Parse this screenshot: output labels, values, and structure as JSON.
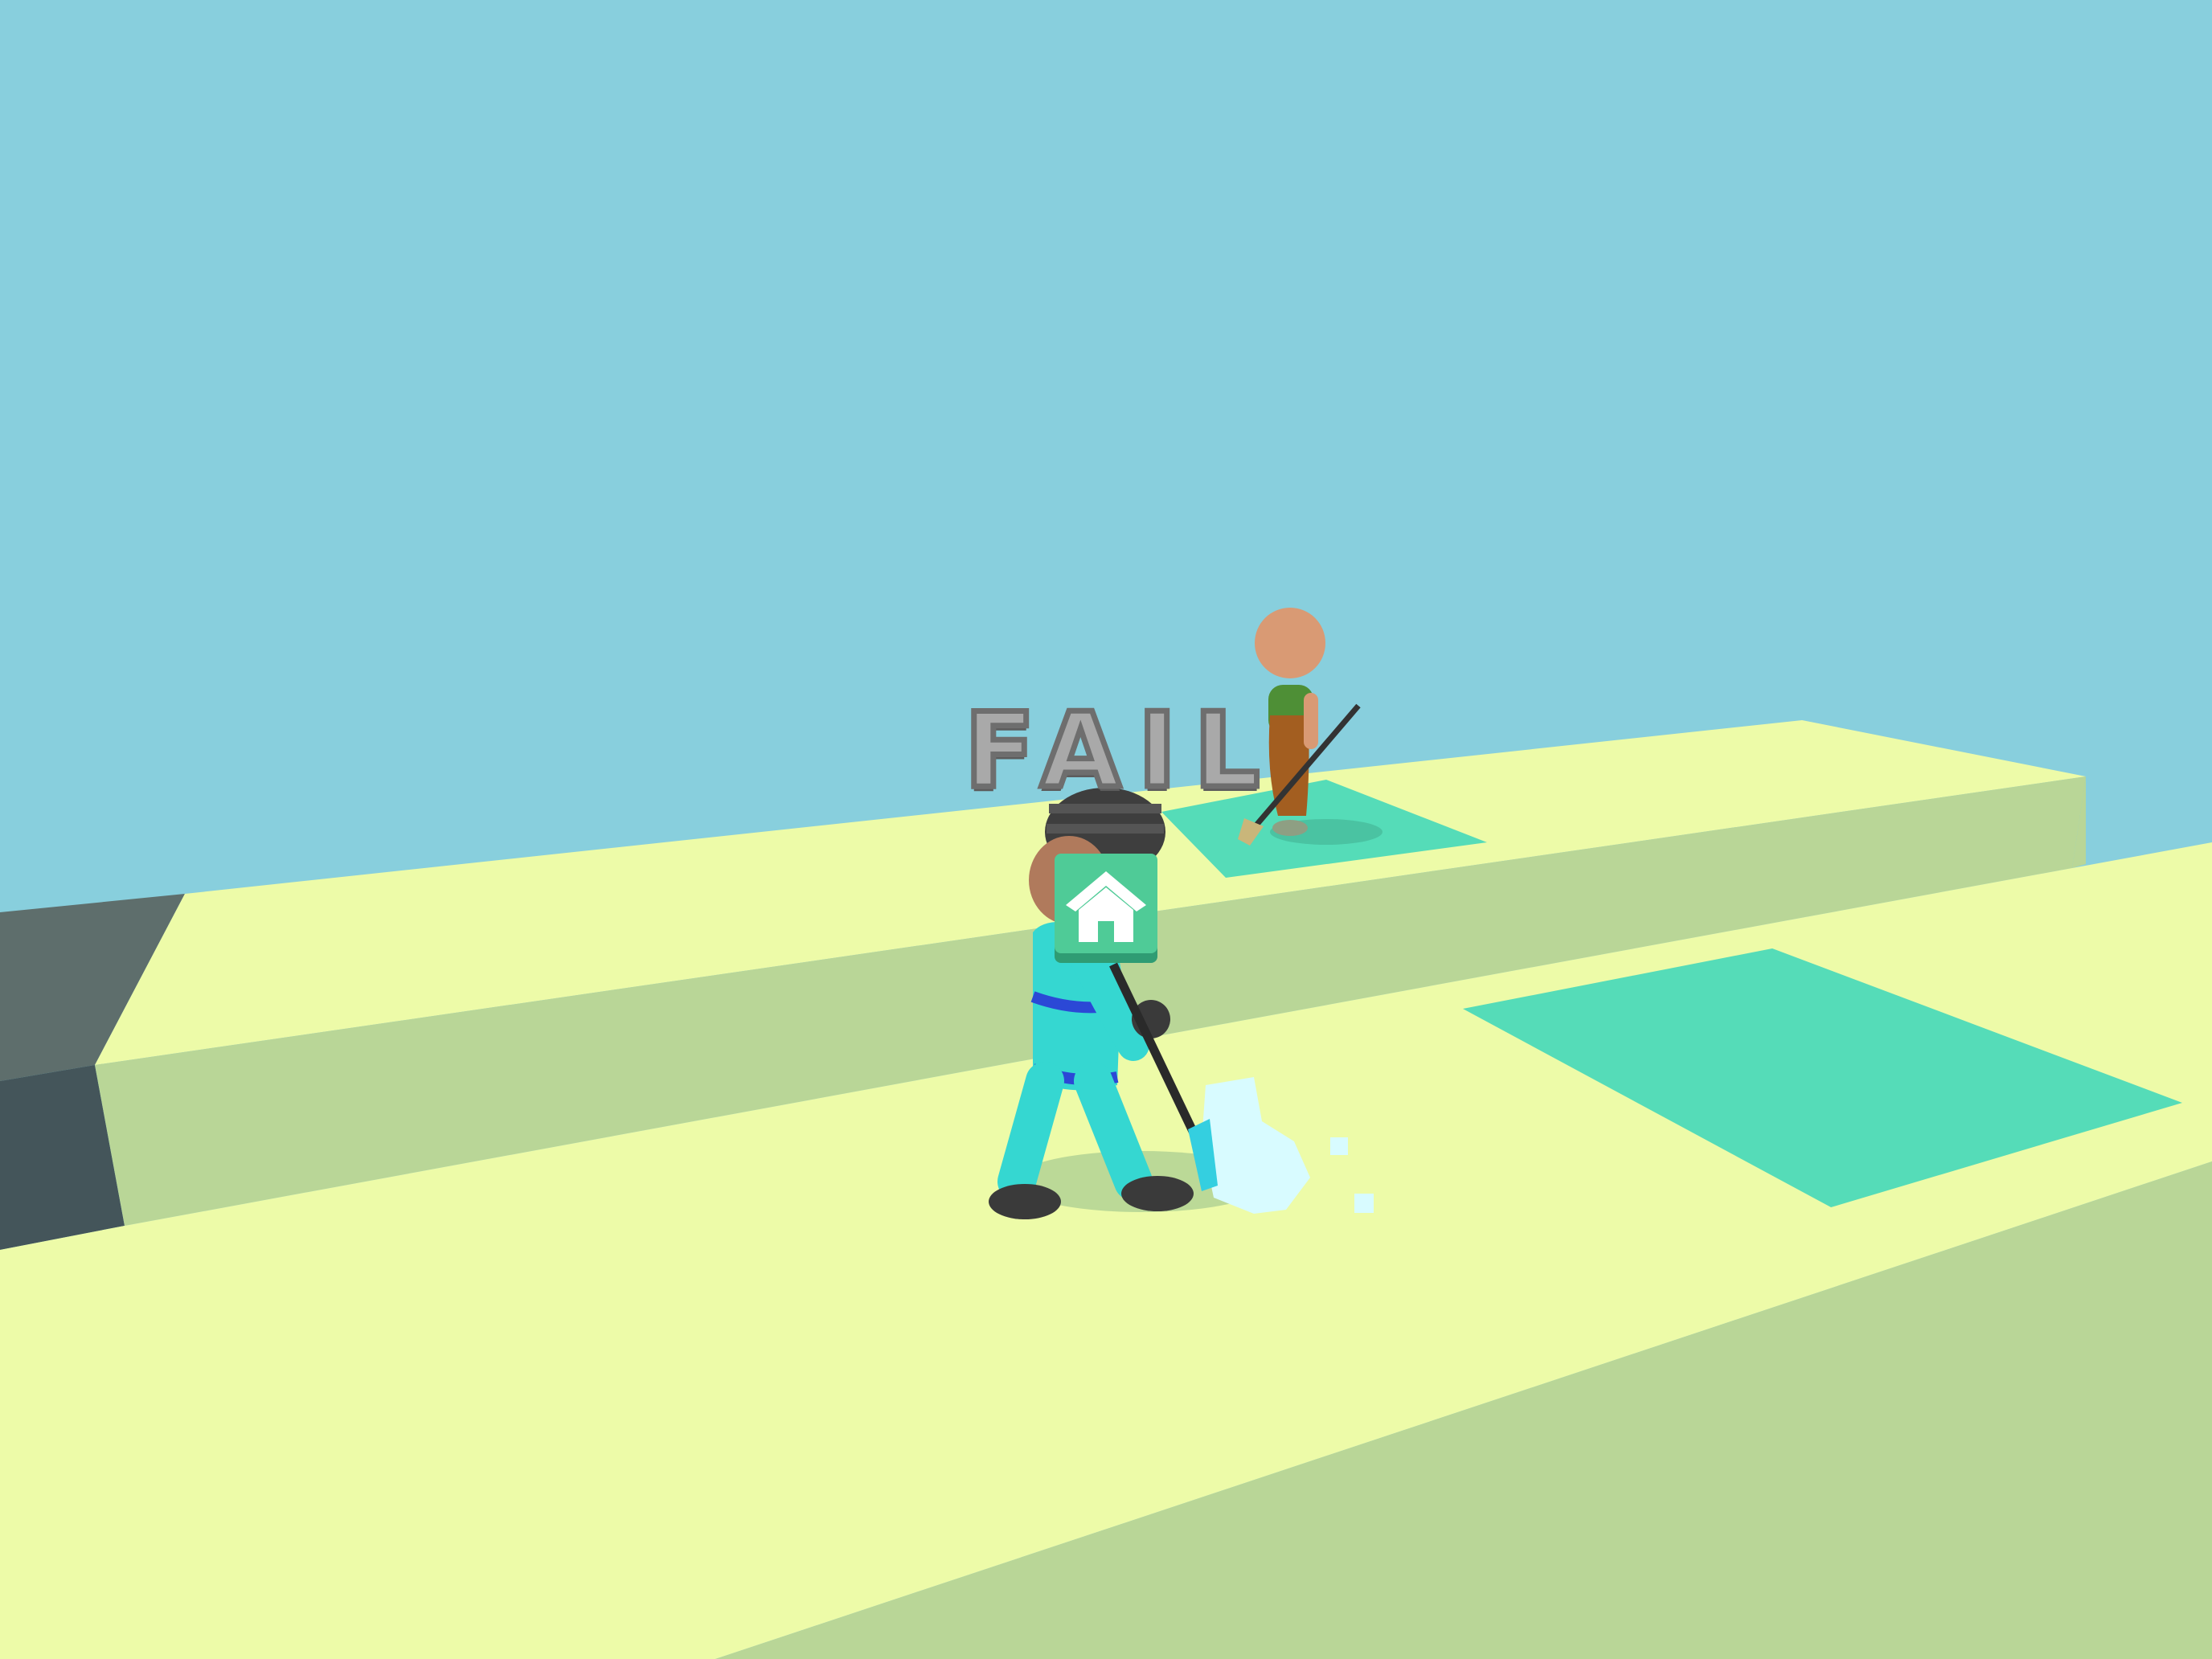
{
  "hud": {
    "result_text": "FAIL",
    "home_button_icon": "home-icon"
  },
  "colors": {
    "sky": "#88CFDD",
    "platform_top": "#EDFBA8",
    "platform_side": "#B9D697",
    "cleaned_tile": "#55DCB8",
    "fail_text": "#A9A9A9",
    "home_button": "#4FCB97"
  }
}
